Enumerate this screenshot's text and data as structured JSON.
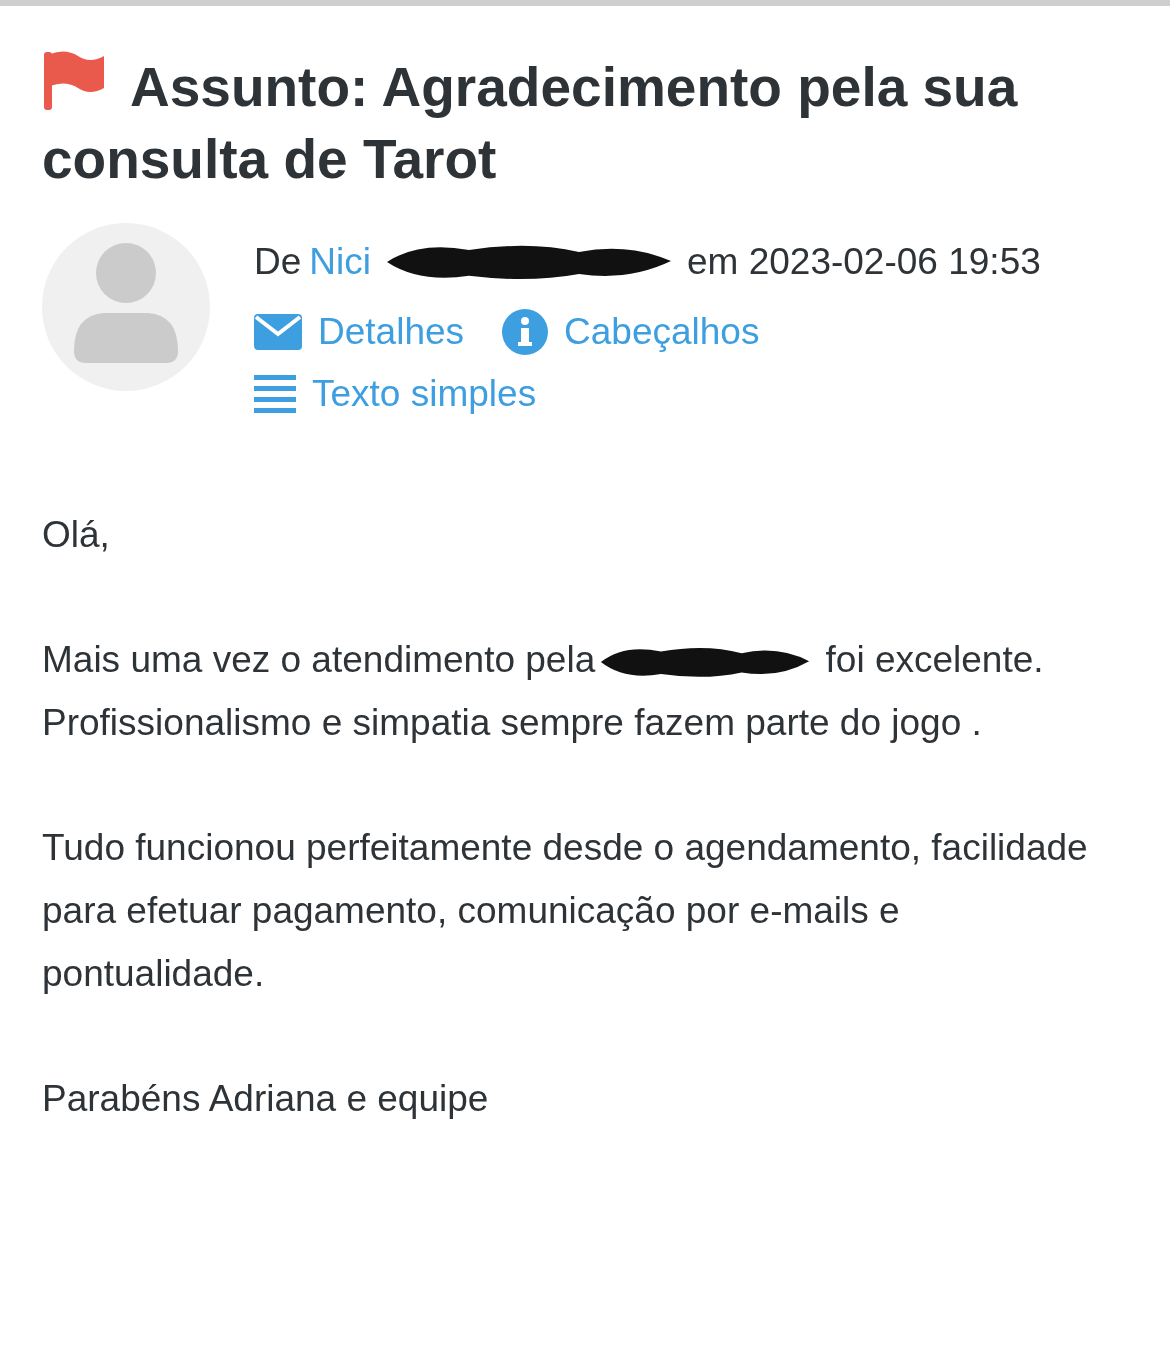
{
  "subject": {
    "flagged": true,
    "text": "Assunto: Agradecimento pela sua consulta de Tarot"
  },
  "sender": {
    "prefix": "De",
    "name": "Nici",
    "redacted": true,
    "date_text": "em 2023-02-06 19:53"
  },
  "links": [
    {
      "kind": "envelope",
      "label": "Detalhes"
    },
    {
      "kind": "info",
      "label": "Cabeçalhos"
    },
    {
      "kind": "list",
      "label": "Texto simples"
    }
  ],
  "body": [
    {
      "text": "Olá,"
    },
    {
      "before": "Mais uma vez o atendimento pela",
      "redacted": true,
      "after": "foi excelente. Profissionalismo e simpatia sempre fazem parte do jogo ."
    },
    {
      "text": "Tudo funcionou perfeitamente desde o agendamento, facilidade para efetuar pagamento, comunicação por e-mails e pontualidade."
    },
    {
      "text": "Parabéns Adriana e equipe"
    }
  ]
}
